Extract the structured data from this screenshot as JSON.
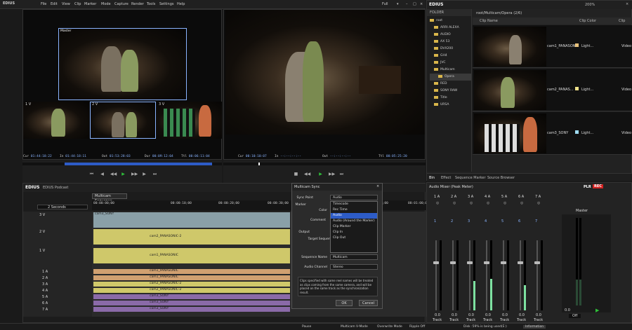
{
  "menubar": {
    "logo": "EDIUS",
    "items": [
      "File",
      "Edit",
      "View",
      "Clip",
      "Marker",
      "Mode",
      "Capture",
      "Render",
      "Tools",
      "Settings",
      "Help"
    ],
    "preset": "Full"
  },
  "player": {
    "inset_label": "Master",
    "cam_labels": [
      "1 V",
      "2 V",
      "3 V"
    ],
    "timecodes": [
      {
        "label": "Cur",
        "value": "01:44:18:22"
      },
      {
        "label": "In",
        "value": "01:44:18:11"
      },
      {
        "label": "Out",
        "value": "01:53:28:03"
      },
      {
        "label": "Dur",
        "value": "00:09:12:04"
      },
      {
        "label": "Ttl",
        "value": "00:06:11:04"
      }
    ]
  },
  "recorder": {
    "timecodes": [
      {
        "label": "Cur",
        "value": "00:10:10:07"
      },
      {
        "label": "In",
        "value": "--:--:--:--"
      },
      {
        "label": "Out",
        "value": "--:--:--:--"
      },
      {
        "label": "Ttl",
        "value": "00:05:25:20"
      }
    ]
  },
  "bin": {
    "logo": "EDIUS",
    "path": "root/Multicam/Opera (2/6)",
    "zoom": "200%",
    "folder_header": "FOLDER",
    "clip_header": "Clip Name",
    "clip_color_header": "Clip Color",
    "clip_col3": "Clip",
    "folders": [
      "root",
      "ARRI ALEXA",
      "AUDIO",
      "AX 53",
      "DVX200",
      "GH4",
      "JVC",
      "Multicam",
      "Opera",
      "RED",
      "SONY RAW",
      "Title",
      "URSA"
    ],
    "clips": [
      {
        "name": "cam1_PANASONIC",
        "color_label": "Light...",
        "extra": "Video",
        "swatch": "#e8c27a"
      },
      {
        "name": "cam2_PANAS...",
        "color_label": "Light...",
        "extra": "Video",
        "swatch": "#f0e28a"
      },
      {
        "name": "cam3_SONY",
        "color_label": "Light...",
        "extra": "Video",
        "swatch": "#9fdcf2"
      }
    ],
    "tabs": [
      "Bin",
      "Effect",
      "Sequence Marker",
      "Source Browser"
    ]
  },
  "timeline": {
    "logo": "EDIUS",
    "project": "EDIUS Podcast",
    "sequence_tab": "Multicam Sequence",
    "scale": "2 Seconds",
    "ruler": [
      "00:00:00;00",
      "00:00:10;00",
      "00:00:20;00",
      "00:00:30;00",
      "00:00:40;00",
      "00:00:50;00",
      "00:01:00;00"
    ],
    "tracks": [
      {
        "label": "3 V",
        "clip": "cam3_SONY",
        "color": "#8aa0a8"
      },
      {
        "label": "2 V",
        "clip": "cam2_PANASONIC-2",
        "color": "#cfc86a"
      },
      {
        "label": "1 V",
        "clip": "cam1_PANASONIC",
        "color": "#cfc86a"
      },
      {
        "label": "1 A",
        "clip": "cam1_PANASONIC",
        "color": "#d0a070"
      },
      {
        "label": "2 A",
        "clip": "cam1_PANASONIC",
        "color": "#d0a070"
      },
      {
        "label": "3 A",
        "clip": "cam2_PANASONIC-2",
        "color": "#cfc86a"
      },
      {
        "label": "4 A",
        "clip": "cam2_PANASONIC-2",
        "color": "#cfc86a"
      },
      {
        "label": "5 A",
        "clip": "cam3_SONY",
        "color": "#8a6aa8"
      },
      {
        "label": "6 A",
        "clip": "cam3_SONY",
        "color": "#8a6aa8"
      },
      {
        "label": "7 A",
        "clip": "cam3_SONY",
        "color": "#8a6aa8"
      }
    ]
  },
  "dialog": {
    "title": "Multicam Sync",
    "sync_point_label": "Sync Point",
    "sync_point_value": "Audio",
    "marker_label": "Marker",
    "color_label": "Color",
    "comment_label": "Comment",
    "output_label": "Output",
    "target_label": "Target Sequence",
    "sequence_name_label": "Sequence Name",
    "sequence_name_value": "Multicam",
    "audio_channel_label": "Audio Channel",
    "audio_channel_value": "Stereo",
    "options": [
      "Timecode",
      "Rec Time",
      "Audio",
      "Audio (Around the Marker)",
      "Clip Marker",
      "Clip In",
      "Clip Out"
    ],
    "selected": "Audio",
    "note": "Clips specified with same reel names will be treated as clips coming from the same camera, and will be placed on the same track as the synchronization result.",
    "ok": "OK",
    "cancel": "Cancel"
  },
  "mixer": {
    "title": "Audio Mixer (Peak Meter)",
    "plr": "PLR",
    "rec": "REC",
    "channels": [
      {
        "name": "1 A",
        "ch": "1",
        "level": 0.0,
        "fill": 0.0
      },
      {
        "name": "2 A",
        "ch": "2",
        "level": 0.0,
        "fill": 0.0
      },
      {
        "name": "3 A",
        "ch": "3",
        "level": 0.0,
        "fill": 0.42
      },
      {
        "name": "4 A",
        "ch": "4",
        "level": 0.0,
        "fill": 0.45
      },
      {
        "name": "5 A",
        "ch": "5",
        "level": 0.0,
        "fill": 0.0
      },
      {
        "name": "6 A",
        "ch": "6",
        "level": 0.0,
        "fill": 0.36
      },
      {
        "name": "7 A",
        "ch": "7",
        "level": 0.0,
        "fill": 0.0
      }
    ],
    "mode": "Track",
    "master": "Master",
    "master_level": "0.0",
    "master_mode": "Off"
  },
  "status": {
    "pause": "Pause",
    "mode": "Multicam V-Mode",
    "overwrite": "Overwrite Mode",
    "ripple": "Ripple Off",
    "disk": "Disk :59% is being used(E:)",
    "info": "Information"
  },
  "colors": {
    "accent": "#2d5cc7",
    "play": "#2fbf3a",
    "rec": "#d12020"
  }
}
